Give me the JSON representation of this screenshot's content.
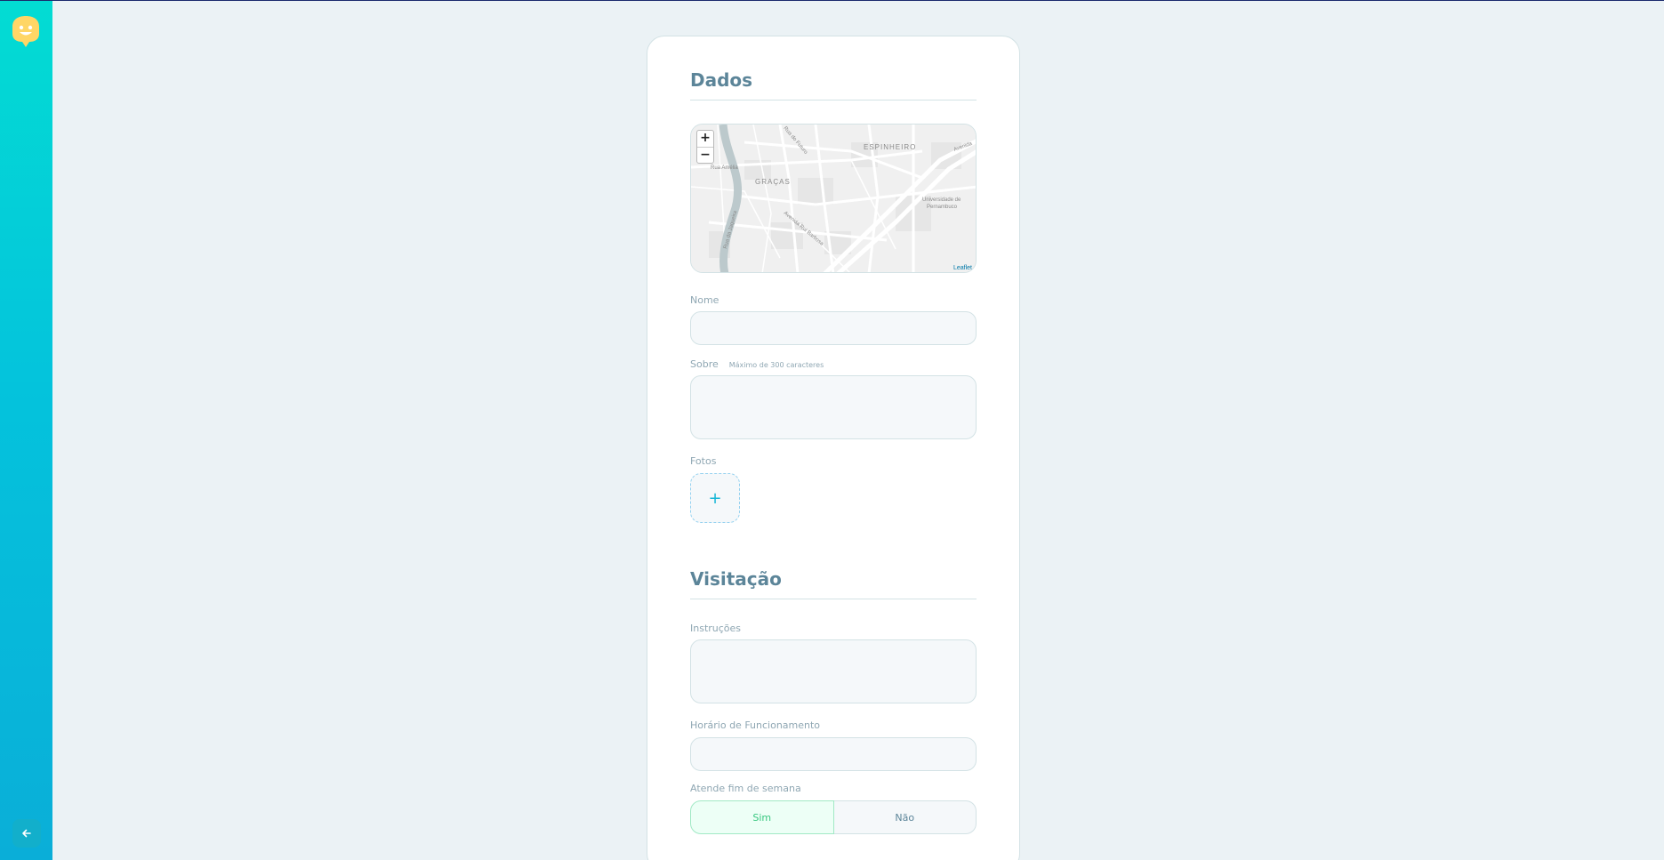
{
  "sidebar": {
    "logo_icon": "happy-face-logo",
    "back_icon": "arrow-left-icon"
  },
  "form": {
    "section_data_title": "Dados",
    "map": {
      "zoom_in": "+",
      "zoom_out": "−",
      "attribution": "Leaflet",
      "labels": [
        "ESPINHEIRO",
        "GRAÇAS",
        "Universidade de Pernambuco",
        "Avenida Rui Barbosa",
        "Rua Amélia",
        "Rua da Jaqueira",
        "Rua do Futuro",
        "Avenida"
      ]
    },
    "name_label": "Nome",
    "name_value": "",
    "about_label": "Sobre",
    "about_hint": "Máximo de 300 caracteres",
    "about_value": "",
    "photos_label": "Fotos",
    "add_photo_symbol": "+",
    "section_visit_title": "Visitação",
    "instructions_label": "Instruções",
    "instructions_value": "",
    "hours_label": "Horário de Funcionamento",
    "hours_value": "",
    "weekend_label": "Atende fim de semana",
    "weekend_yes": "Sim",
    "weekend_no": "Não",
    "weekend_selected": "Sim"
  },
  "colors": {
    "sidebar_gradient_top": "#03dcd3",
    "sidebar_gradient_bottom": "#0aaed8",
    "logo": "#ffd666",
    "title": "#5c8599",
    "selected_green": "#37c77f"
  }
}
